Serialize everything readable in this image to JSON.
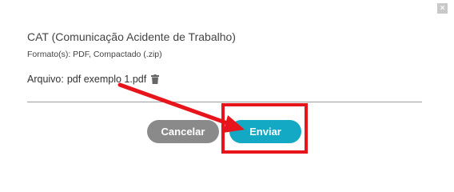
{
  "dialog": {
    "close_label": "×",
    "title": "CAT (Comunicação Acidente de Trabalho)",
    "formats": "Formato(s): PDF, Compactado (.zip)",
    "file_label": "Arquivo:",
    "file_name": "pdf exemplo 1.pdf",
    "cancel_label": "Cancelar",
    "send_label": "Enviar"
  },
  "colors": {
    "cancel_button": "#8a8a8a",
    "send_button": "#13a8c4",
    "annotation": "#e8141b"
  },
  "icons": {
    "close": "close-icon",
    "delete": "trash-icon"
  }
}
